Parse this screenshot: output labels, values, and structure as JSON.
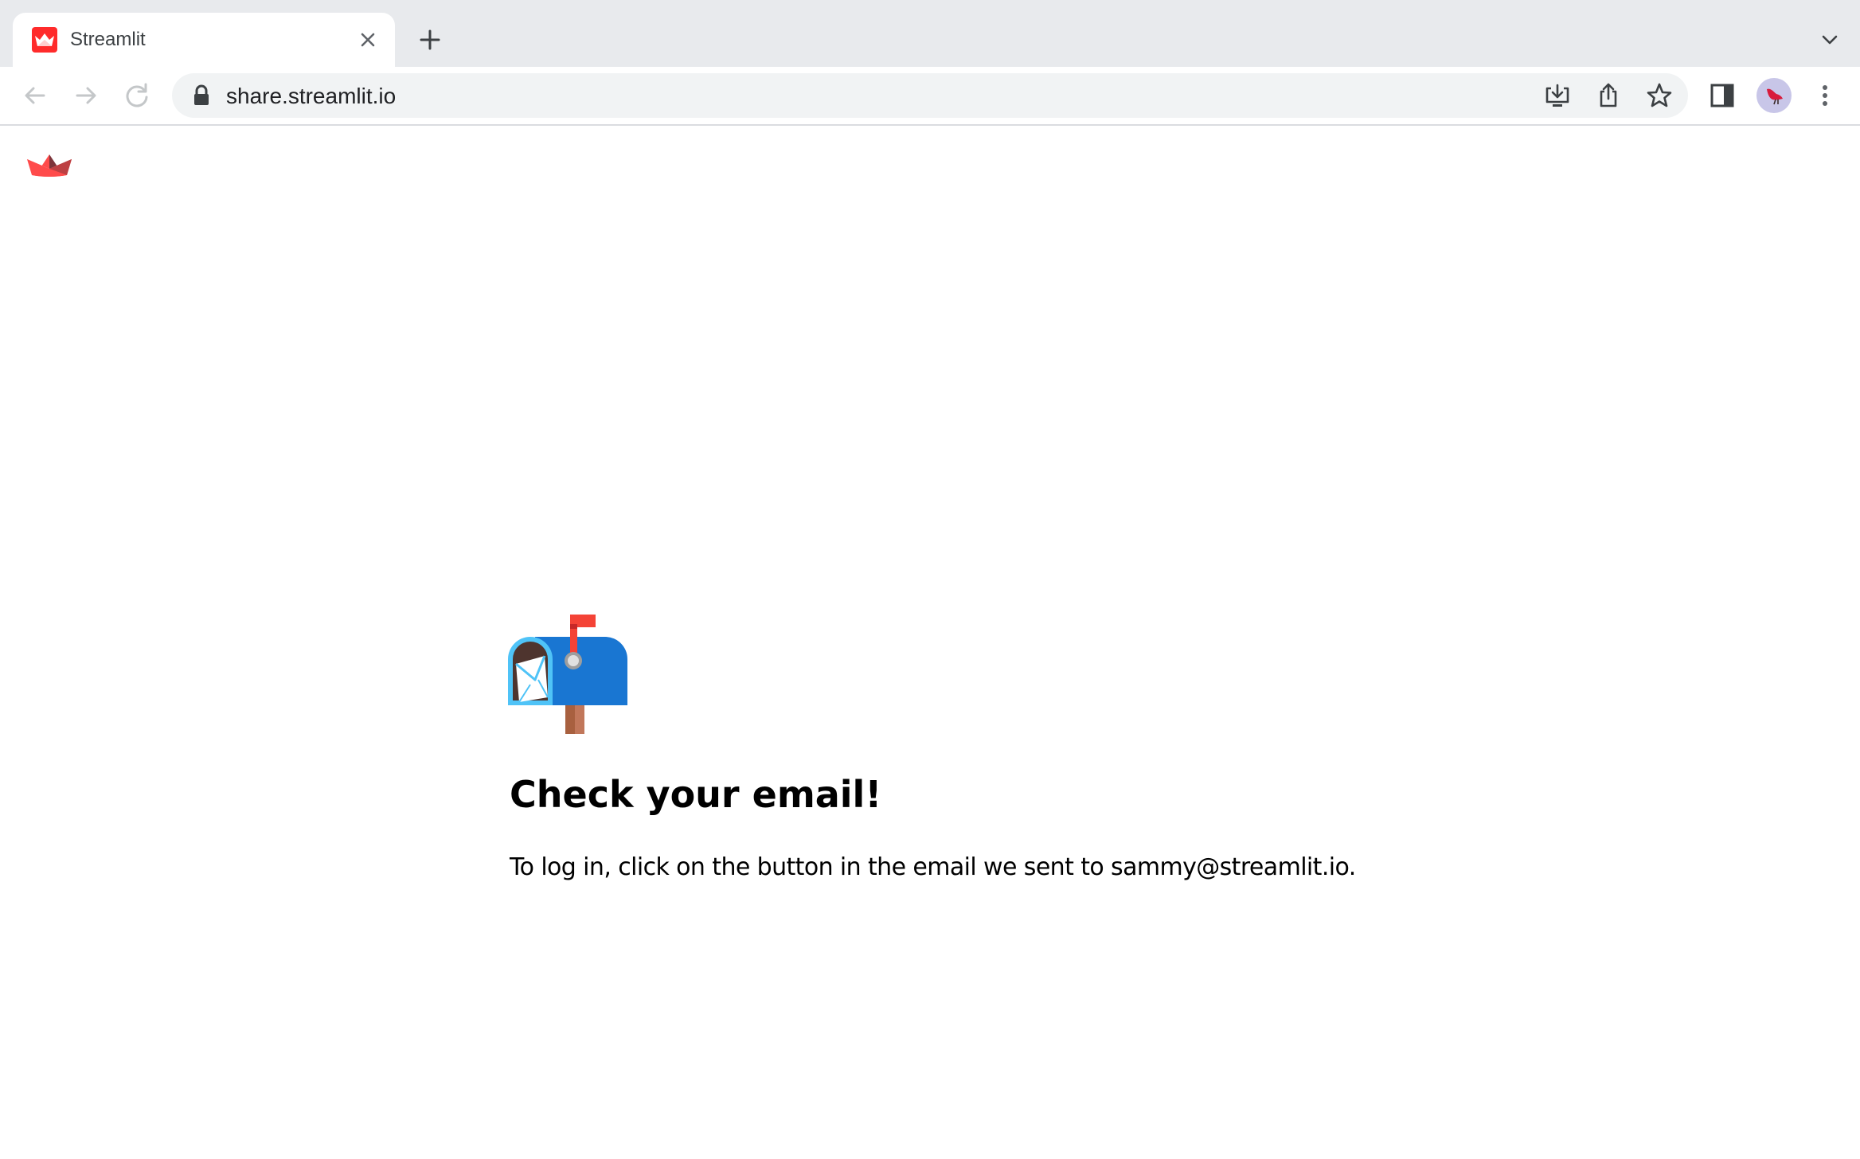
{
  "browser": {
    "tab": {
      "title": "Streamlit",
      "favicon": "streamlit-crown-icon",
      "close_icon": "close-icon"
    },
    "new_tab_icon": "plus-icon",
    "tab_search_icon": "chevron-down-icon",
    "toolbar": {
      "back_icon": "arrow-left-icon",
      "forward_icon": "arrow-right-icon",
      "reload_icon": "reload-icon",
      "url": "share.streamlit.io",
      "lock_icon": "lock-icon",
      "install_icon": "install-app-icon",
      "share_icon": "share-icon",
      "bookmark_icon": "star-icon",
      "side_panel_icon": "side-panel-icon",
      "profile_icon": "avatar",
      "menu_icon": "kebab-menu-icon"
    }
  },
  "page": {
    "logo": "streamlit-logo-icon",
    "illustration": "mailbox-icon",
    "title": "Check your email!",
    "message": "To log in, click on the button in the email we sent to sammy@streamlit.io."
  },
  "colors": {
    "streamlit_red": "#ff4b4b",
    "tabstrip_bg": "#e8eaed",
    "omnibox_bg": "#f1f3f4",
    "mailbox_blue": "#1976d2",
    "flag_red": "#f44336"
  }
}
